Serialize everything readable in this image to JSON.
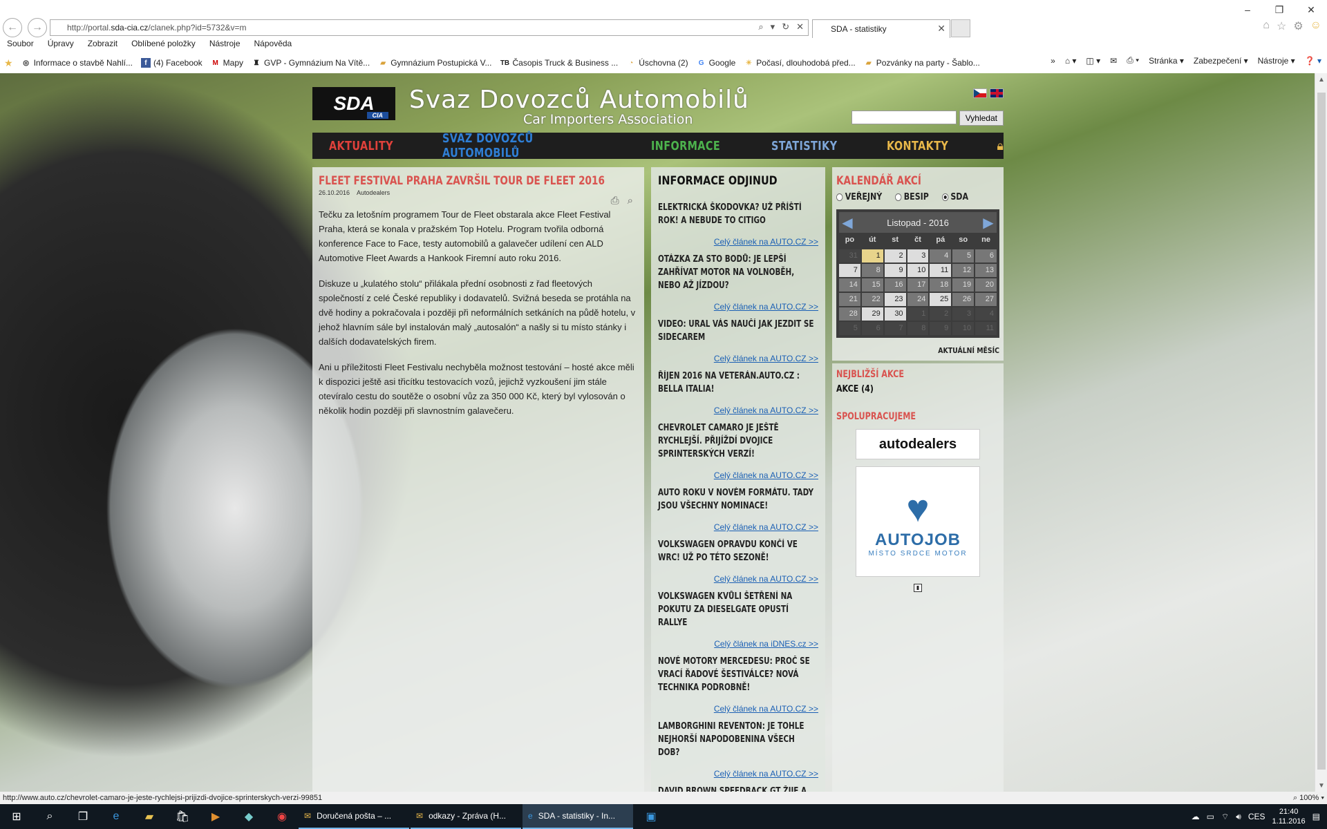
{
  "browser": {
    "url_prefix": "http://portal.",
    "url_domain": "sda-cia.cz",
    "url_path": "/clanek.php?id=5732&v=m",
    "tab_title": "SDA - statistiky",
    "menu": [
      "Soubor",
      "Úpravy",
      "Zobrazit",
      "Oblíbené položky",
      "Nástroje",
      "Nápověda"
    ],
    "favorites": [
      {
        "label": "Informace o stavbě Nahlí...",
        "icon": "globe-icon"
      },
      {
        "label": "(4) Facebook",
        "icon": "facebook-icon"
      },
      {
        "label": "Mapy",
        "icon": "maps-icon"
      },
      {
        "label": "GVP - Gymnázium Na Vítě...",
        "icon": "school-icon"
      },
      {
        "label": "Gymnázium Postupická  V...",
        "icon": "folder-icon"
      },
      {
        "label": "Časopis Truck & Business ...",
        "icon": "tb-icon"
      },
      {
        "label": "Úschovna (2)",
        "icon": "uschovna-icon"
      },
      {
        "label": "Google",
        "icon": "google-icon"
      },
      {
        "label": "Počasí, dlouhodobá před...",
        "icon": "weather-icon"
      },
      {
        "label": "Pozvánky na party - Šablo...",
        "icon": "folder-icon"
      }
    ],
    "commands": [
      "Stránka",
      "Zabezpečení",
      "Nástroje"
    ],
    "status_url": "http://www.auto.cz/chevrolet-camaro-je-jeste-rychlejsi-prijizdi-dvojice-sprinterskych-verzi-99851",
    "zoom": "100%"
  },
  "site": {
    "logo": "SDA",
    "logo_sub": "CIA",
    "title": "Svaz Dovozců Automobilů",
    "subtitle": "Car Importers Association",
    "search_button": "Vyhledat",
    "nav": [
      {
        "label": "AKTUALITY",
        "color": "#e0413b"
      },
      {
        "label": "SVAZ DOVOZCŮ AUTOMOBILŮ",
        "color": "#2f7fd6"
      },
      {
        "label": "INFORMACE",
        "color": "#4db34d"
      },
      {
        "label": "STATISTIKY",
        "color": "#7ea6d8"
      },
      {
        "label": "KONTAKTY",
        "color": "#e8b84a"
      }
    ]
  },
  "article": {
    "title": "Fleet Festival Praha završil Tour de Fleet 2016",
    "date": "26.10.2016",
    "source": "Autodealers",
    "paragraphs": [
      "Tečku za letošním programem Tour de Fleet obstarala akce Fleet Festival Praha, která se konala v pražském Top Hotelu. Program tvořila odborná konference Face to Face, testy automobilů a galavečer udílení cen ALD Automotive Fleet Awards a Hankook Firemní auto roku 2016.",
      "Diskuze u „kulatého stolu“ přilákala přední osobnosti z řad fleetových společností z celé České republiky i dodavatelů. Svižná beseda se protáhla na dvě hodiny a pokračovala i později při neformálních setkáních na půdě hotelu, v jehož hlavním sále byl instalován malý „autosalón“ a našly si tu místo stánky i dalších dodavatelských firem.",
      "Ani u příležitosti Fleet Festivalu nechyběla možnost testování – hosté akce měli k dispozici ještě asi třicítku testovacích vozů, jejichž vyzkoušení jim stále otevíralo cestu do soutěže o osobní vůz za 350 000 Kč, který byl vylosován o několik hodin později při slavnostním galavečeru."
    ]
  },
  "external": {
    "heading": "Informace odjinud",
    "items": [
      {
        "title": "Elektrická Škodovka? Už příští rok! A nebude to Citigo",
        "link": "Celý článek na AUTO.CZ >>"
      },
      {
        "title": "Otázka za sto bodů: Je lepší zahřívat motor na volnoběh, nebo až jízdou?",
        "link": "Celý článek na AUTO.CZ >>"
      },
      {
        "title": "Video: Ural vás naučí jak jezdit se sidecarem",
        "link": "Celý článek na AUTO.CZ >>"
      },
      {
        "title": "Říjen 2016 na Veterán.auto.cz : Bella Italia!",
        "link": "Celý článek na AUTO.CZ >>"
      },
      {
        "title": "Chevrolet Camaro je ještě rychlejší. Přijíždí dvojice sprinterských verzí!",
        "link": "Celý článek na AUTO.CZ >>"
      },
      {
        "title": "Auto roku v novém formátu. Tady jsou všechny nominace!",
        "link": "Celý článek na AUTO.CZ >>"
      },
      {
        "title": "Volkswagen opravdu končí ve WRC! Už po této sezoně!",
        "link": "Celý článek na AUTO.CZ >>"
      },
      {
        "title": "Volkswagen kvůli šetření na pokutu za dieselgate opustí rallye",
        "link": "Celý článek na iDNES.cz >>"
      },
      {
        "title": "Nové motory Mercedesu: Proč se vrací řadové šestiválce? Nová technika podrobně!",
        "link": "Celý článek na AUTO.CZ >>"
      },
      {
        "title": "Lamborghini Reventon: Je tohle nejhorší napodobenina všech dob?",
        "link": "Celý článek na AUTO.CZ >>"
      },
      {
        "title": "David Brown Speedback GT žije a čeká",
        "link": ""
      }
    ]
  },
  "calendar": {
    "heading": "Kalendář akcí",
    "filters": [
      {
        "label": "Veřejný",
        "checked": false
      },
      {
        "label": "BESIP",
        "checked": false
      },
      {
        "label": "SDA",
        "checked": true
      }
    ],
    "month": "Listopad - 2016",
    "weekdays": [
      "po",
      "út",
      "st",
      "čt",
      "pá",
      "so",
      "ne"
    ],
    "days": [
      [
        "31",
        "out"
      ],
      [
        "1",
        "today"
      ],
      [
        "2",
        "wk"
      ],
      [
        "3",
        "wk"
      ],
      [
        "4",
        ""
      ],
      [
        "5",
        ""
      ],
      [
        "6",
        ""
      ],
      [
        "7",
        "wk"
      ],
      [
        "8",
        ""
      ],
      [
        "9",
        "wk"
      ],
      [
        "10",
        "wk"
      ],
      [
        "11",
        "wk"
      ],
      [
        "12",
        ""
      ],
      [
        "13",
        ""
      ],
      [
        "14",
        ""
      ],
      [
        "15",
        ""
      ],
      [
        "16",
        ""
      ],
      [
        "17",
        ""
      ],
      [
        "18",
        ""
      ],
      [
        "19",
        ""
      ],
      [
        "20",
        ""
      ],
      [
        "21",
        ""
      ],
      [
        "22",
        ""
      ],
      [
        "23",
        "wk"
      ],
      [
        "24",
        ""
      ],
      [
        "25",
        "wk"
      ],
      [
        "26",
        ""
      ],
      [
        "27",
        ""
      ],
      [
        "28",
        ""
      ],
      [
        "29",
        "wk"
      ],
      [
        "30",
        "wk"
      ],
      [
        "1",
        "out"
      ],
      [
        "2",
        "out"
      ],
      [
        "3",
        "out"
      ],
      [
        "4",
        "out"
      ],
      [
        "5",
        "out"
      ],
      [
        "6",
        "out"
      ],
      [
        "7",
        "out"
      ],
      [
        "8",
        "out"
      ],
      [
        "9",
        "out"
      ],
      [
        "10",
        "out"
      ],
      [
        "11",
        "out"
      ]
    ],
    "current_month": "Aktuální měsíc"
  },
  "sidebar": {
    "nearest_heading": "Nejbližší akce",
    "nearest_item": "Akce (4)",
    "partners_heading": "Spolupracujeme",
    "partner1": "autodealers",
    "partner2_name": "AUTOJOB",
    "partner2_tag": "MÍSTO SRDCE MOTOR"
  },
  "taskbar": {
    "apps": [
      {
        "label": "Doručená pošta – ...",
        "icon": "mail-icon",
        "active": false
      },
      {
        "label": "odkazy - Zpráva (H...",
        "icon": "message-icon",
        "active": false
      },
      {
        "label": "SDA - statistiky - In...",
        "icon": "ie-icon",
        "active": true
      }
    ],
    "lang": "CES",
    "time": "21:40",
    "date": "1.11.2016"
  }
}
